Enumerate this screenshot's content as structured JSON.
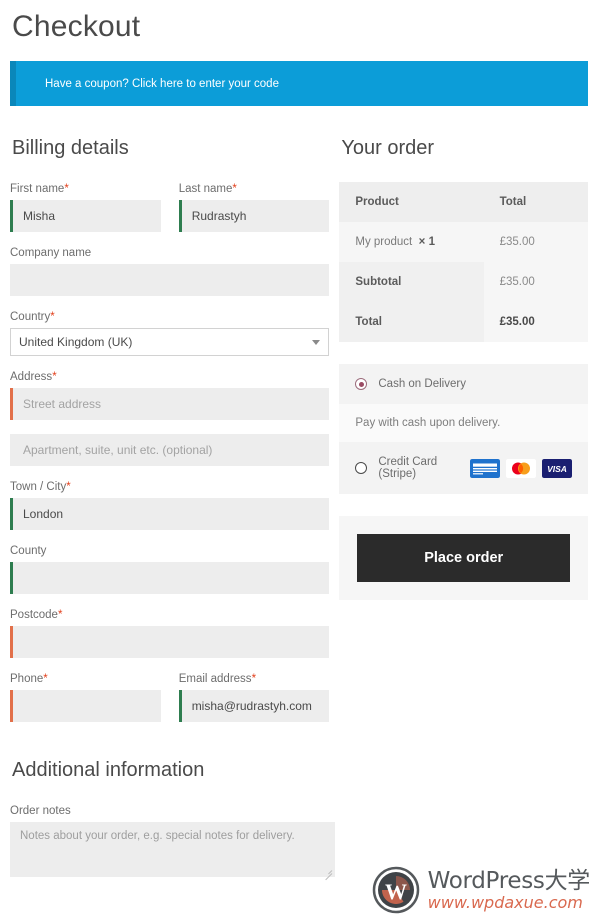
{
  "page": {
    "title": "Checkout"
  },
  "coupon": {
    "text": "Have a coupon? Click here to enter your code"
  },
  "billing": {
    "section_title": "Billing details",
    "fields": {
      "first_name": {
        "label": "First name",
        "required": "*",
        "value": "Misha",
        "placeholder": "",
        "state": "valid"
      },
      "last_name": {
        "label": "Last name",
        "required": "*",
        "value": "Rudrastyh",
        "placeholder": "",
        "state": "valid"
      },
      "company": {
        "label": "Company name",
        "required": "",
        "value": "",
        "placeholder": "",
        "state": "plain"
      },
      "country": {
        "label": "Country",
        "required": "*",
        "value": "United Kingdom (UK)"
      },
      "address_1": {
        "label": "Address",
        "required": "*",
        "value": "",
        "placeholder": "Street address",
        "state": "invalid"
      },
      "address_2": {
        "label": "",
        "required": "",
        "value": "",
        "placeholder": "Apartment, suite, unit etc. (optional)",
        "state": "plain"
      },
      "city": {
        "label": "Town / City",
        "required": "*",
        "value": "London",
        "placeholder": "",
        "state": "valid"
      },
      "county": {
        "label": "County",
        "required": "",
        "value": "",
        "placeholder": "",
        "state": "valid"
      },
      "postcode": {
        "label": "Postcode",
        "required": "*",
        "value": "",
        "placeholder": "",
        "state": "invalid"
      },
      "phone": {
        "label": "Phone",
        "required": "*",
        "value": "",
        "placeholder": "",
        "state": "invalid"
      },
      "email": {
        "label": "Email address",
        "required": "*",
        "value": "misha@rudrastyh.com",
        "placeholder": "",
        "state": "valid"
      }
    }
  },
  "additional": {
    "section_title": "Additional information",
    "order_notes": {
      "label": "Order notes",
      "value": "",
      "placeholder": "Notes about your order, e.g. special notes for delivery."
    }
  },
  "order": {
    "section_title": "Your order",
    "headers": {
      "product": "Product",
      "total": "Total"
    },
    "items": [
      {
        "name": "My product",
        "qty": "× 1",
        "total": "£35.00"
      }
    ],
    "subtotal": {
      "label": "Subtotal",
      "value": "£35.00"
    },
    "total": {
      "label": "Total",
      "value": "£35.00"
    }
  },
  "payment": {
    "methods": [
      {
        "id": "cod",
        "label": "Cash on Delivery",
        "selected": true,
        "description": "Pay with cash upon delivery."
      },
      {
        "id": "stripe",
        "label": "Credit Card (Stripe)",
        "selected": false,
        "cards": [
          "amex",
          "mastercard",
          "visa"
        ]
      }
    ],
    "place_order_label": "Place order"
  },
  "watermark": {
    "title": "WordPress大学",
    "url": "www.wpdaxue.com"
  },
  "colors": {
    "coupon_bg": "#0c9dd8",
    "coupon_accent": "#0a87ba",
    "valid_border": "#2e7d4f",
    "invalid_border": "#e2704a",
    "required_asterisk": "#e2401c",
    "place_order_bg": "#2b2b2b",
    "radio_selected": "#9b4b63"
  }
}
